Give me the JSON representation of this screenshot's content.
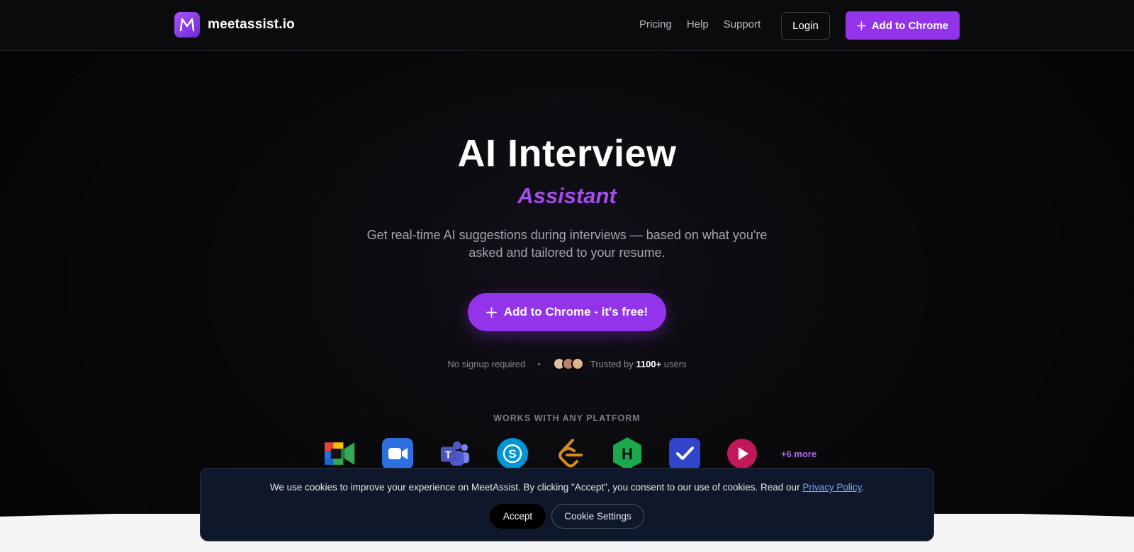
{
  "brand": {
    "name": "meetassist.io",
    "logo_icon": "m-logo-icon",
    "accent": "#9333ea"
  },
  "nav": {
    "links": [
      "Pricing",
      "Help",
      "Support"
    ],
    "login_label": "Login",
    "chrome_label": "Add to Chrome"
  },
  "hero": {
    "title": "AI Interview",
    "subtitle": "Assistant",
    "description": "Get real-time AI suggestions during interviews — based on what you're asked and tailored to your resume.",
    "cta_label": "Add to Chrome - it's free!"
  },
  "meta": {
    "no_signup": "No signup required",
    "trusted_prefix": "Trusted by",
    "trusted_count": "1100+",
    "trusted_suffix": "users"
  },
  "platforms": {
    "heading": "WORKS WITH ANY PLATFORM",
    "icons": [
      "google-meet-icon",
      "zoom-icon",
      "teams-icon",
      "skype-icon",
      "leetcode-icon",
      "hackerrank-icon",
      "check-app-icon",
      "play-app-icon"
    ],
    "more_label": "+6 more"
  },
  "cookie": {
    "text": "We use cookies to improve your experience on MeetAssist. By clicking \"Accept\", you consent to our use of cookies. Read our",
    "link_label": "Privacy Policy",
    "period": ".",
    "accept_label": "Accept",
    "settings_label": "Cookie Settings"
  }
}
